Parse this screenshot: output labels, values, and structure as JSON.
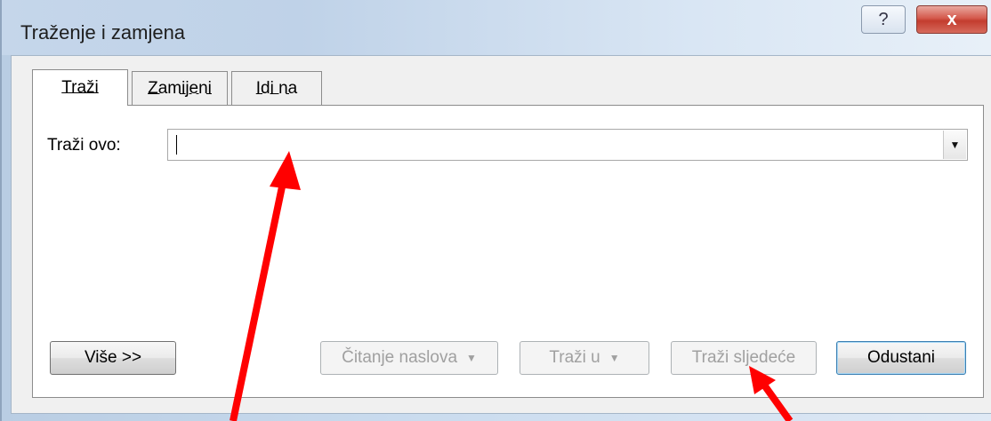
{
  "window": {
    "title": "Traženje i zamjena"
  },
  "titlebar": {
    "help_label": "?",
    "close_label": "x"
  },
  "tabs": [
    {
      "label": "Traži",
      "active": true
    },
    {
      "label": "Zamijeni",
      "active": false
    },
    {
      "label": "Idi na",
      "active": false
    }
  ],
  "find": {
    "label": "Traži ovo:",
    "value": "",
    "dropdown_glyph": "▼"
  },
  "buttons": {
    "more": "Više >>",
    "reading_highlight": "Čitanje naslova",
    "find_in": "Traži u",
    "find_next": "Traži sljedeće",
    "cancel": "Odustani"
  },
  "colors": {
    "annotation_arrow": "#ff0000",
    "close_button": "#c33c2e"
  }
}
